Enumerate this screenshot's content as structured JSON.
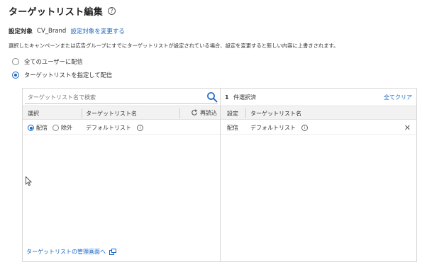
{
  "header": {
    "title": "ターゲットリスト編集",
    "help_icon": "?"
  },
  "target": {
    "label": "設定対象",
    "value": "CV_Brand",
    "change_link": "設定対象を変更する"
  },
  "description": "選択したキャンペーンまたは広告グループにすでにターゲットリストが設定されている場合、設定を変更すると新しい内容に上書きされます。",
  "options": [
    {
      "label": "全てのユーザーに配信",
      "selected": false
    },
    {
      "label": "ターゲットリストを指定して配信",
      "selected": true
    }
  ],
  "left_pane": {
    "search_placeholder": "ターゲットリスト名で検索",
    "col_select": "選択",
    "col_name": "ターゲットリスト名",
    "reload_label": "再読込",
    "rows": [
      {
        "deliver_label": "配信",
        "exclude_label": "除外",
        "deliver_selected": true,
        "name": "デフォルトリスト"
      }
    ],
    "footer_link": "ターゲットリストの管理画面へ"
  },
  "right_pane": {
    "count_number": "1",
    "count_label": "件選択済",
    "clear_all": "全てクリア",
    "col_setting": "設定",
    "col_name": "ターゲットリスト名",
    "rows": [
      {
        "setting": "配信",
        "name": "デフォルトリスト"
      }
    ]
  },
  "colors": {
    "accent": "#1a66c2",
    "header_bg": "#f2f2f2",
    "border": "#d6d6d6"
  },
  "icons": [
    "help-icon",
    "search-icon",
    "reload-icon",
    "info-icon",
    "external-link-icon",
    "close-icon",
    "mouse-cursor-icon"
  ]
}
